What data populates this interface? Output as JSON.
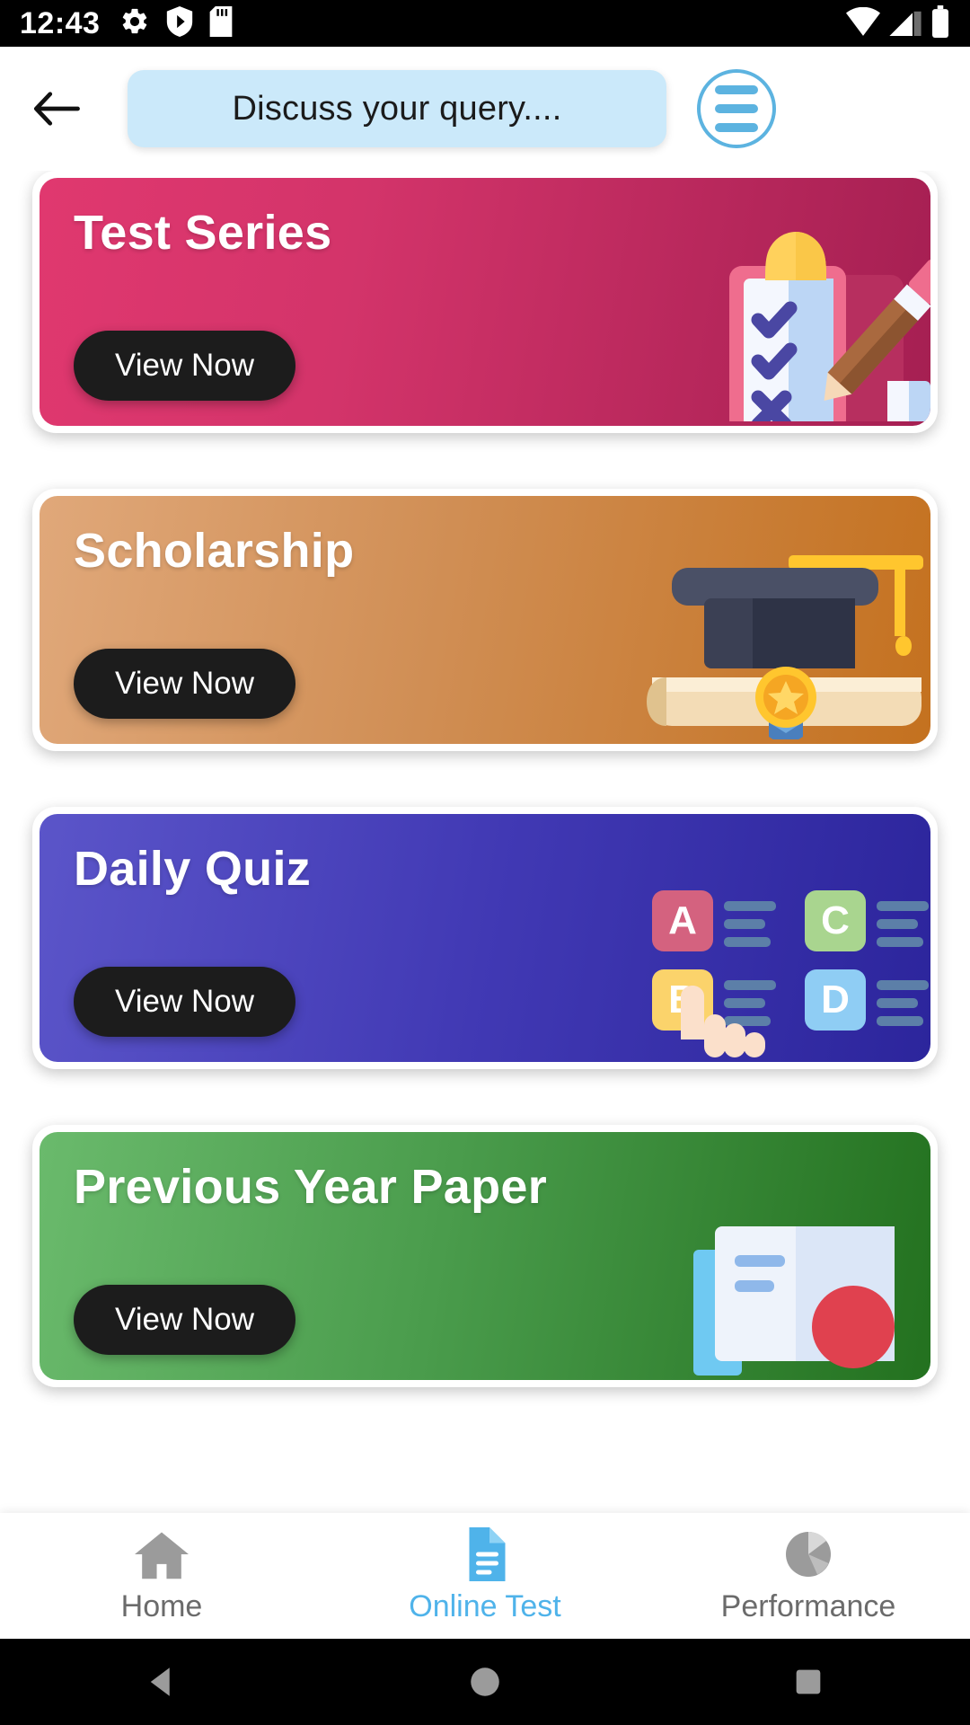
{
  "status_bar": {
    "time": "12:43",
    "left_icons": [
      "gear-icon",
      "play-protect-icon",
      "sd-card-icon"
    ],
    "right_icons": [
      "wifi-icon",
      "signal-icon",
      "battery-icon"
    ]
  },
  "header": {
    "back_label": "←",
    "query_text": "Discuss your query....",
    "menu_icon": "hamburger-menu-icon"
  },
  "cards": [
    {
      "title": "Test Series",
      "button_label": "View Now",
      "theme": "c-test",
      "accent": "#d3346a",
      "illustration": "clipboard-checklist-pencil"
    },
    {
      "title": "Scholarship",
      "button_label": "View Now",
      "theme": "c-schol",
      "accent": "#c4711f",
      "illustration": "graduation-cap-diploma-medal"
    },
    {
      "title": "Daily Quiz",
      "button_label": "View Now",
      "theme": "c-quiz",
      "accent": "#4139b4",
      "illustration": "abcd-options-hand",
      "options": [
        "A",
        "B",
        "C",
        "D"
      ]
    },
    {
      "title": "Previous Year Paper",
      "button_label": "View Now",
      "theme": "c-prev",
      "accent": "#4a9c4c",
      "illustration": "papers-documents"
    }
  ],
  "bottom_nav": {
    "items": [
      {
        "label": "Home",
        "icon": "home-icon",
        "active": false
      },
      {
        "label": "Online Test",
        "icon": "document-icon",
        "active": true
      },
      {
        "label": "Performance",
        "icon": "pie-chart-icon",
        "active": false
      }
    ],
    "active_color": "#4fb3ea",
    "inactive_color": "#6b6b6b"
  },
  "android_nav": {
    "back": "back-triangle-icon",
    "home": "home-circle-icon",
    "recents": "recents-square-icon"
  }
}
